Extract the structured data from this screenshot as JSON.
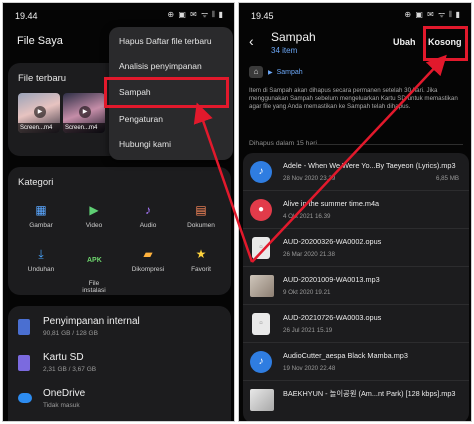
{
  "left": {
    "status": {
      "time": "19.44",
      "icons": "⊕ ▣ ✉ ᯤ 𝄃 ▮"
    },
    "app_title": "File Saya",
    "recent": {
      "title": "File terbaru",
      "thumbs": [
        {
          "label": "Screen...m4"
        },
        {
          "label": "Screen...m4"
        }
      ]
    },
    "menu": {
      "items": [
        "Hapus Daftar file terbaru",
        "Analisis penyimpanan",
        "Sampah",
        "Pengaturan",
        "Hubungi kami"
      ]
    },
    "kategori": {
      "title": "Kategori",
      "items": [
        {
          "label": "Gambar",
          "icon": "image-icon",
          "color": "#5aa7ff"
        },
        {
          "label": "Video",
          "icon": "video-icon",
          "color": "#5fcf74"
        },
        {
          "label": "Audio",
          "icon": "music-icon",
          "color": "#a978ff"
        },
        {
          "label": "Dokumen",
          "icon": "document-icon",
          "color": "#ff8a5c"
        },
        {
          "label": "Unduhan",
          "icon": "download-icon",
          "color": "#49a6ff"
        },
        {
          "label": "File\ninstalasi",
          "icon": "apk-icon",
          "color": "#6cd36c"
        },
        {
          "label": "Dikompresi",
          "icon": "zip-icon",
          "color": "#ffb23d"
        },
        {
          "label": "Favorit",
          "icon": "star-icon",
          "color": "#ffd33d"
        }
      ]
    },
    "storage": [
      {
        "name": "Penyimpanan internal",
        "sub": "90,81 GB / 128 GB",
        "icon": "phone-storage-icon"
      },
      {
        "name": "Kartu SD",
        "sub": "2,31 GB / 3,67 GB",
        "icon": "sd-card-icon"
      },
      {
        "name": "OneDrive",
        "sub": "Tidak masuk",
        "icon": "cloud-icon"
      }
    ]
  },
  "right": {
    "status": {
      "time": "19.45",
      "icons": "⊕ ▣ ✉ ᯤ 𝄃 ▮"
    },
    "title": "Sampah",
    "count": "34 item",
    "actions": {
      "edit": "Ubah",
      "empty": "Kosong"
    },
    "breadcrumb": "Sampah",
    "info": "Item di Sampah akan dihapus secara permanen setelah 30 hari. Jika menggunakan Sampah sebelum mengeluarkan Kartu SD untuk memastikan agar file yang Anda memastikan ke Sampah telah dihapus.",
    "section": "Dihapus dalam 15 hari",
    "files": [
      {
        "name": "Adele - When We Were Yo...By Taeyeon (Lyrics).mp3",
        "date": "28 Nov 2020 23.39",
        "size": "6,85 MB",
        "type": "audio"
      },
      {
        "name": "Alive in the summer time.m4a",
        "date": "4 Okt 2021 16.39",
        "size": "",
        "type": "voice"
      },
      {
        "name": "AUD-20200326-WA0002.opus",
        "date": "26 Mar 2020 21.38",
        "size": "",
        "type": "doc"
      },
      {
        "name": "AUD-20201009-WA0013.mp3",
        "date": "9 Okt 2020 19.21",
        "size": "",
        "type": "image"
      },
      {
        "name": "AUD-20210726-WA0003.opus",
        "date": "26 Jul 2021 15.19",
        "size": "",
        "type": "doc"
      },
      {
        "name": "AudioCutter_aespa   Black Mamba.mp3",
        "date": "19 Nov 2020 22.48",
        "size": "",
        "type": "audio"
      },
      {
        "name": "BAEKHYUN - 놀이공원 (Am...nt Park) [128 kbps].mp3",
        "date": "",
        "size": "",
        "type": "image"
      }
    ]
  },
  "colors": {
    "highlight": "#e2192c",
    "accent": "#6ba6f5"
  }
}
